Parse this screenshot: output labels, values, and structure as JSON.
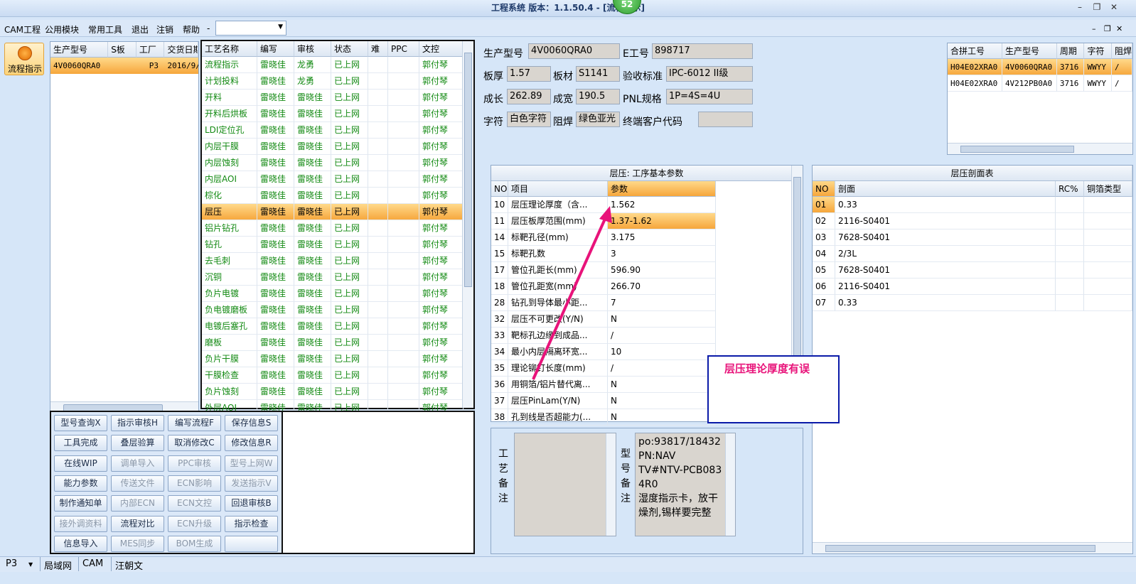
{
  "window": {
    "title": "工程系统  版本：1.1.50.4 - [流程指示]",
    "badge": "52"
  },
  "menu": {
    "items": [
      "CAM工程",
      "公用模块",
      "常用工具",
      "退出",
      "注销",
      "帮助"
    ],
    "extra": "-"
  },
  "sidenav": {
    "label": "流程指示"
  },
  "left_table": {
    "headers": [
      "生产型号",
      "S板",
      "工厂",
      "交货日期"
    ],
    "rows": [
      [
        "4V0060QRA0",
        "",
        "P3",
        "2016/9/"
      ]
    ]
  },
  "flow_table": {
    "headers": [
      "工艺名称",
      "编写",
      "审核",
      "状态",
      "难",
      "PPC",
      "文控"
    ],
    "rows": [
      [
        "流程指示",
        "雷晓佳",
        "龙勇",
        "已上网",
        "",
        "",
        "郭付琴"
      ],
      [
        "计划投料",
        "雷晓佳",
        "龙勇",
        "已上网",
        "",
        "",
        "郭付琴"
      ],
      [
        "开料",
        "雷晓佳",
        "雷晓佳",
        "已上网",
        "",
        "",
        "郭付琴"
      ],
      [
        "开料后烘板",
        "雷晓佳",
        "雷晓佳",
        "已上网",
        "",
        "",
        "郭付琴"
      ],
      [
        "LDI定位孔",
        "雷晓佳",
        "雷晓佳",
        "已上网",
        "",
        "",
        "郭付琴"
      ],
      [
        "内层干膜",
        "雷晓佳",
        "雷晓佳",
        "已上网",
        "",
        "",
        "郭付琴"
      ],
      [
        "内层蚀刻",
        "雷晓佳",
        "雷晓佳",
        "已上网",
        "",
        "",
        "郭付琴"
      ],
      [
        "内层AOI",
        "雷晓佳",
        "雷晓佳",
        "已上网",
        "",
        "",
        "郭付琴"
      ],
      [
        "棕化",
        "雷晓佳",
        "雷晓佳",
        "已上网",
        "",
        "",
        "郭付琴"
      ],
      [
        "层压",
        "雷晓佳",
        "雷晓佳",
        "已上网",
        "",
        "",
        "郭付琴"
      ],
      [
        "铝片钻孔",
        "雷晓佳",
        "雷晓佳",
        "已上网",
        "",
        "",
        "郭付琴"
      ],
      [
        "钻孔",
        "雷晓佳",
        "雷晓佳",
        "已上网",
        "",
        "",
        "郭付琴"
      ],
      [
        "去毛刺",
        "雷晓佳",
        "雷晓佳",
        "已上网",
        "",
        "",
        "郭付琴"
      ],
      [
        "沉铜",
        "雷晓佳",
        "雷晓佳",
        "已上网",
        "",
        "",
        "郭付琴"
      ],
      [
        "负片电镀",
        "雷晓佳",
        "雷晓佳",
        "已上网",
        "",
        "",
        "郭付琴"
      ],
      [
        "负电镀磨板",
        "雷晓佳",
        "雷晓佳",
        "已上网",
        "",
        "",
        "郭付琴"
      ],
      [
        "电镀后塞孔",
        "雷晓佳",
        "雷晓佳",
        "已上网",
        "",
        "",
        "郭付琴"
      ],
      [
        "磨板",
        "雷晓佳",
        "雷晓佳",
        "已上网",
        "",
        "",
        "郭付琴"
      ],
      [
        "负片干膜",
        "雷晓佳",
        "雷晓佳",
        "已上网",
        "",
        "",
        "郭付琴"
      ],
      [
        "干膜检查",
        "雷晓佳",
        "雷晓佳",
        "已上网",
        "",
        "",
        "郭付琴"
      ],
      [
        "负片蚀刻",
        "雷晓佳",
        "雷晓佳",
        "已上网",
        "",
        "",
        "郭付琴"
      ],
      [
        "外层AOI",
        "雷晓佳",
        "雷晓佳",
        "已上网",
        "",
        "",
        "郭付琴"
      ]
    ],
    "selected": 9
  },
  "buttons": [
    [
      "型号查询X",
      "指示审核H",
      "编写流程F",
      "保存信息S"
    ],
    [
      "工具完成",
      "叠层验算",
      "取消修改C",
      "修改信息R"
    ],
    [
      "在线WIP",
      "调单导入",
      "PPC审核",
      "型号上网W"
    ],
    [
      "能力参数",
      "传送文件",
      "ECN影响",
      "发送指示V"
    ],
    [
      "制作通知单",
      "内部ECN",
      "ECN文控",
      "回退审核B"
    ],
    [
      "接外调资料",
      "流程对比",
      "ECN升级",
      "指示检查"
    ],
    [
      "信息导入",
      "MES同步",
      "BOM生成",
      ""
    ]
  ],
  "buttons_disabled": [
    [
      false,
      false,
      false,
      false
    ],
    [
      false,
      false,
      false,
      false
    ],
    [
      false,
      true,
      true,
      true
    ],
    [
      false,
      true,
      true,
      true
    ],
    [
      false,
      true,
      true,
      false
    ],
    [
      true,
      false,
      true,
      false
    ],
    [
      false,
      true,
      true,
      false
    ]
  ],
  "info": {
    "prod_model_label": "生产型号",
    "prod_model": "4V0060QRA0",
    "e_label": "E工号",
    "e_no": "898717",
    "thick_label": "板厚",
    "thick": "1.57",
    "mat_label": "板材",
    "mat": "S1141",
    "std_label": "验收标准",
    "std": "IPC-6012 II级",
    "grow_label": "成长",
    "grow": "262.89",
    "width_label": "成宽",
    "width": "190.5",
    "pnl_label": "PNL规格",
    "pnl": "1P=4S=4U",
    "char_label": "字符",
    "char": "白色字符",
    "mask_label": "阻焊",
    "mask": "绿色亚光",
    "cust_label": "终端客户代码",
    "cust": ""
  },
  "merge_table": {
    "headers": [
      "合拼工号",
      "生产型号",
      "周期",
      "字符",
      "阻焊"
    ],
    "rows": [
      [
        "H04E02XRA0",
        "4V0060QRA0",
        "3716",
        "WWYY",
        "/"
      ],
      [
        "H04E02XRA0",
        "4V212PB0A0",
        "3716",
        "WWYY",
        "/"
      ]
    ]
  },
  "param_table": {
    "title": "层压: 工序基本参数",
    "headers": [
      "NO",
      "项目",
      "参数"
    ],
    "rows": [
      [
        "10",
        "层压理论厚度（含...",
        "1.562"
      ],
      [
        "11",
        "层压板厚范围(mm)",
        "1.37-1.62"
      ],
      [
        "14",
        "标靶孔径(mm)",
        "3.175"
      ],
      [
        "15",
        "标靶孔数",
        "3"
      ],
      [
        "17",
        "管位孔距长(mm)",
        "596.90"
      ],
      [
        "18",
        "管位孔距宽(mm)",
        "266.70"
      ],
      [
        "28",
        "钻孔到导体最小距...",
        "7"
      ],
      [
        "32",
        "层压不可更改(Y/N)",
        "N"
      ],
      [
        "33",
        "靶标孔边缘到成品...",
        "/"
      ],
      [
        "34",
        "最小内层隔离环宽...",
        "10"
      ],
      [
        "35",
        "理论铆钉长度(mm)",
        "/"
      ],
      [
        "36",
        "用铜箔/铝片替代离...",
        "N"
      ],
      [
        "37",
        "层压PinLam(Y/N)",
        "N"
      ],
      [
        "38",
        "孔到线是否超能力(...",
        "N"
      ]
    ],
    "selected": 1
  },
  "section_table": {
    "title": "层压剖面表",
    "headers": [
      "NO",
      "剖面",
      "RC%",
      "铜箔类型"
    ],
    "rows": [
      [
        "01",
        "0.33",
        "",
        ""
      ],
      [
        "02",
        "2116-S0401",
        "",
        ""
      ],
      [
        "03",
        "7628-S0401",
        "",
        ""
      ],
      [
        "04",
        "2/3L",
        "",
        ""
      ],
      [
        "05",
        "7628-S0401",
        "",
        ""
      ],
      [
        "06",
        "2116-S0401",
        "",
        ""
      ],
      [
        "07",
        "0.33",
        "",
        ""
      ]
    ]
  },
  "remarks": {
    "process_label": "工艺备注",
    "model_label": "型号备注",
    "model_text": [
      "po:93817/18432",
      "PN:NAV",
      "TV#NTV-PCB083",
      "4R0",
      "湿度指示卡，放干",
      "燥剂,锡样要完整"
    ]
  },
  "annotation": {
    "text": "层压理论厚度有误"
  },
  "status": {
    "factory": "P3",
    "items": [
      "局域网",
      "CAM",
      "汪朝文"
    ]
  },
  "colors": {
    "accent": "#f6a63b",
    "green_text": "#138a13",
    "annotation": "#e8137a"
  }
}
